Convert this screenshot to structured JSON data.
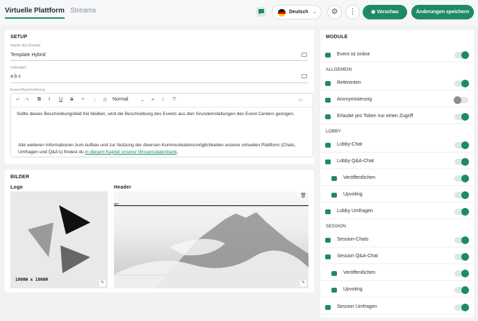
{
  "topbar": {
    "tabs": [
      "Virtuelle Plattform",
      "Streams"
    ],
    "language": "Deutsch",
    "preview_label": "Vorschau",
    "save_label": "Änderungen speichern"
  },
  "setup": {
    "title": "SETUP",
    "event_name_label": "Name des Events",
    "event_name_value": "Template Hybrid",
    "subtitle_label": "Untertitel",
    "subtitle_value": "a b c",
    "description_label": "Event-Beschreibung",
    "style_select": "Normal",
    "description_p1": "Sollte dieses Beschreibungsfeld frei bleiben, wird die Beschreibung des Events aus den Grundeinstellungen des Event Centers gezogen.",
    "description_p2": "Alle weiteren Informationen zum Aufbau und zur Nutzung der diversen Kommunikationsmöglichkeiten unserer virtuellen Plattform (Chats, Umfragen und Q&A's) findest du ",
    "description_link": "in diesem Kapitel unserer Wissensdatenbank",
    "description_end": "."
  },
  "images": {
    "title": "BILDER",
    "logo_label": "Logo",
    "header_label": "Header",
    "logo_size": "1000W x 1000H",
    "header_mark": "ago"
  },
  "modules": {
    "title": "MODULE",
    "items": [
      {
        "label": "Event ist online",
        "on": true,
        "icon": "globe-icon"
      },
      {
        "section": "ALLGEMEIN"
      },
      {
        "label": "Referenten",
        "on": true,
        "icon": "people-icon"
      },
      {
        "label": "Anonymisierung",
        "on": false,
        "icon": "incognito-icon"
      },
      {
        "label": "Erlaube pro Token nur einen Zugriff",
        "on": true,
        "icon": "user-lock-icon"
      },
      {
        "section": "LOBBY"
      },
      {
        "label": "Lobby-Chat",
        "on": true,
        "icon": "chat-icon"
      },
      {
        "label": "Lobby Q&A-Chat",
        "on": true,
        "icon": "qa-chat-icon"
      },
      {
        "label": "Veröffentlichen",
        "on": true,
        "icon": "publish-icon",
        "sub": true
      },
      {
        "label": "Upvoting",
        "on": true,
        "icon": "thumbs-up-icon",
        "sub": true
      },
      {
        "label": "Lobby Umfragen",
        "on": true,
        "icon": "bar-chart-icon"
      },
      {
        "section": "SESSION"
      },
      {
        "label": "Session-Chats",
        "on": true,
        "icon": "chat-icon"
      },
      {
        "label": "Session Q&A-Chat",
        "on": true,
        "icon": "qa-chat-icon"
      },
      {
        "label": "Veröffentlichen",
        "on": true,
        "icon": "publish-icon",
        "sub": true
      },
      {
        "label": "Upvoting",
        "on": true,
        "icon": "thumbs-up-icon",
        "sub": true
      },
      {
        "label": "Session Umfragen",
        "on": true,
        "icon": "bar-chart-icon"
      }
    ]
  },
  "colors": {
    "accent": "#1e8a66"
  }
}
